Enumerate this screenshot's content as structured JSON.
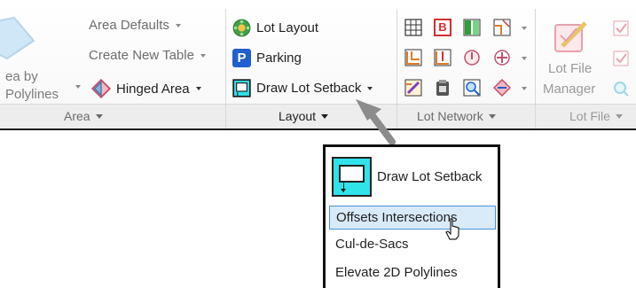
{
  "ribbon": {
    "area_panel": {
      "area_by_label_line1": "ea by",
      "area_by_label_line2": "Polylines",
      "area_defaults": "Area Defaults",
      "create_new_table": "Create New Table",
      "hinged_area": "Hinged Area",
      "title": "Area"
    },
    "layout_panel": {
      "lot_layout": "Lot Layout",
      "parking": "Parking",
      "parking_glyph": "P",
      "draw_lot_setback": "Draw Lot Setback",
      "title": "Layout"
    },
    "lot_network_panel": {
      "title": "Lot Network",
      "b_icon_glyph": "B"
    },
    "lot_file_panel": {
      "manager_line1": "Lot File",
      "manager_line2": "Manager",
      "title": "Lot File"
    }
  },
  "dropdown": {
    "header_label": "Draw Lot Setback",
    "items": [
      "Offsets Intersections",
      "Cul-de-Sacs",
      "Elevate 2D Polylines"
    ],
    "highlighted_item": "Offsets Intersections"
  },
  "colors": {
    "accent_cyan": "#2fe3e8",
    "highlight": "#d9eaf9",
    "highlight_border": "#4a90d9",
    "parking_blue": "#1f5fcf"
  }
}
